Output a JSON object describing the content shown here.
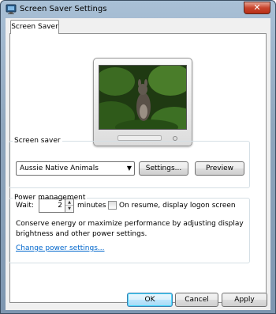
{
  "window": {
    "title": "Screen Saver Settings",
    "close_glyph": "✕"
  },
  "tabs": [
    {
      "label": "Screen Saver"
    }
  ],
  "screen_saver": {
    "group_label": "Screen saver",
    "selected": "Aussie Native Animals",
    "settings_label": "Settings...",
    "preview_label": "Preview",
    "wait_label": "Wait:",
    "wait_value": "2",
    "minutes_label": "minutes",
    "resume_label": "On resume, display logon screen",
    "resume_checked": false
  },
  "power": {
    "group_label": "Power management",
    "description": "Conserve energy or maximize performance by adjusting display brightness and other power settings.",
    "link_label": "Change power settings..."
  },
  "buttons": {
    "ok": "OK",
    "cancel": "Cancel",
    "apply": "Apply"
  },
  "icons": {
    "app": "screen-saver-app-icon",
    "dropdown": "chevron-down-icon",
    "spin_up": "spin-up-icon",
    "spin_down": "spin-down-icon"
  },
  "colors": {
    "link": "#0066cc",
    "close_button": "#c8442c",
    "frame": "#8fa6bd"
  }
}
